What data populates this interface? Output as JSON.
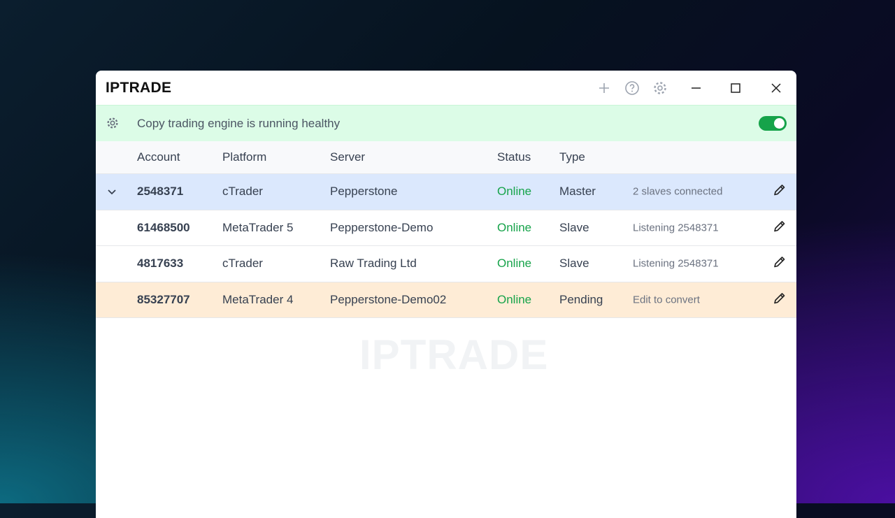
{
  "app": {
    "title": "IPTRADE",
    "watermark": "IPTRADE"
  },
  "titlebar": {
    "icons": [
      "plus-icon",
      "help-icon",
      "gear-icon",
      "minimize-icon",
      "maximize-icon",
      "close-icon"
    ]
  },
  "banner": {
    "text": "Copy trading engine is running healthy",
    "toggle_on": true,
    "color": "#16a34a"
  },
  "table": {
    "headers": [
      "Account",
      "Platform",
      "Server",
      "Status",
      "Type"
    ],
    "rows": [
      {
        "account": "2548371",
        "platform": "cTrader",
        "server": "Pepperstone",
        "status": "Online",
        "type": "Master",
        "info": "2 slaves connected",
        "expanded": true,
        "bg": "#dbe8fd"
      },
      {
        "account": "61468500",
        "platform": "MetaTrader 5",
        "server": "Pepperstone-Demo",
        "status": "Online",
        "type": "Slave",
        "info": "Listening 2548371",
        "bg": "#ffffff"
      },
      {
        "account": "4817633",
        "platform": "cTrader",
        "server": "Raw Trading Ltd",
        "status": "Online",
        "type": "Slave",
        "info": "Listening 2548371",
        "bg": "#ffffff"
      },
      {
        "account": "85327707",
        "platform": "MetaTrader 4",
        "server": "Pepperstone-Demo02",
        "status": "Online",
        "type": "Pending",
        "info": "Edit to convert",
        "bg": "#feecd6"
      }
    ]
  }
}
